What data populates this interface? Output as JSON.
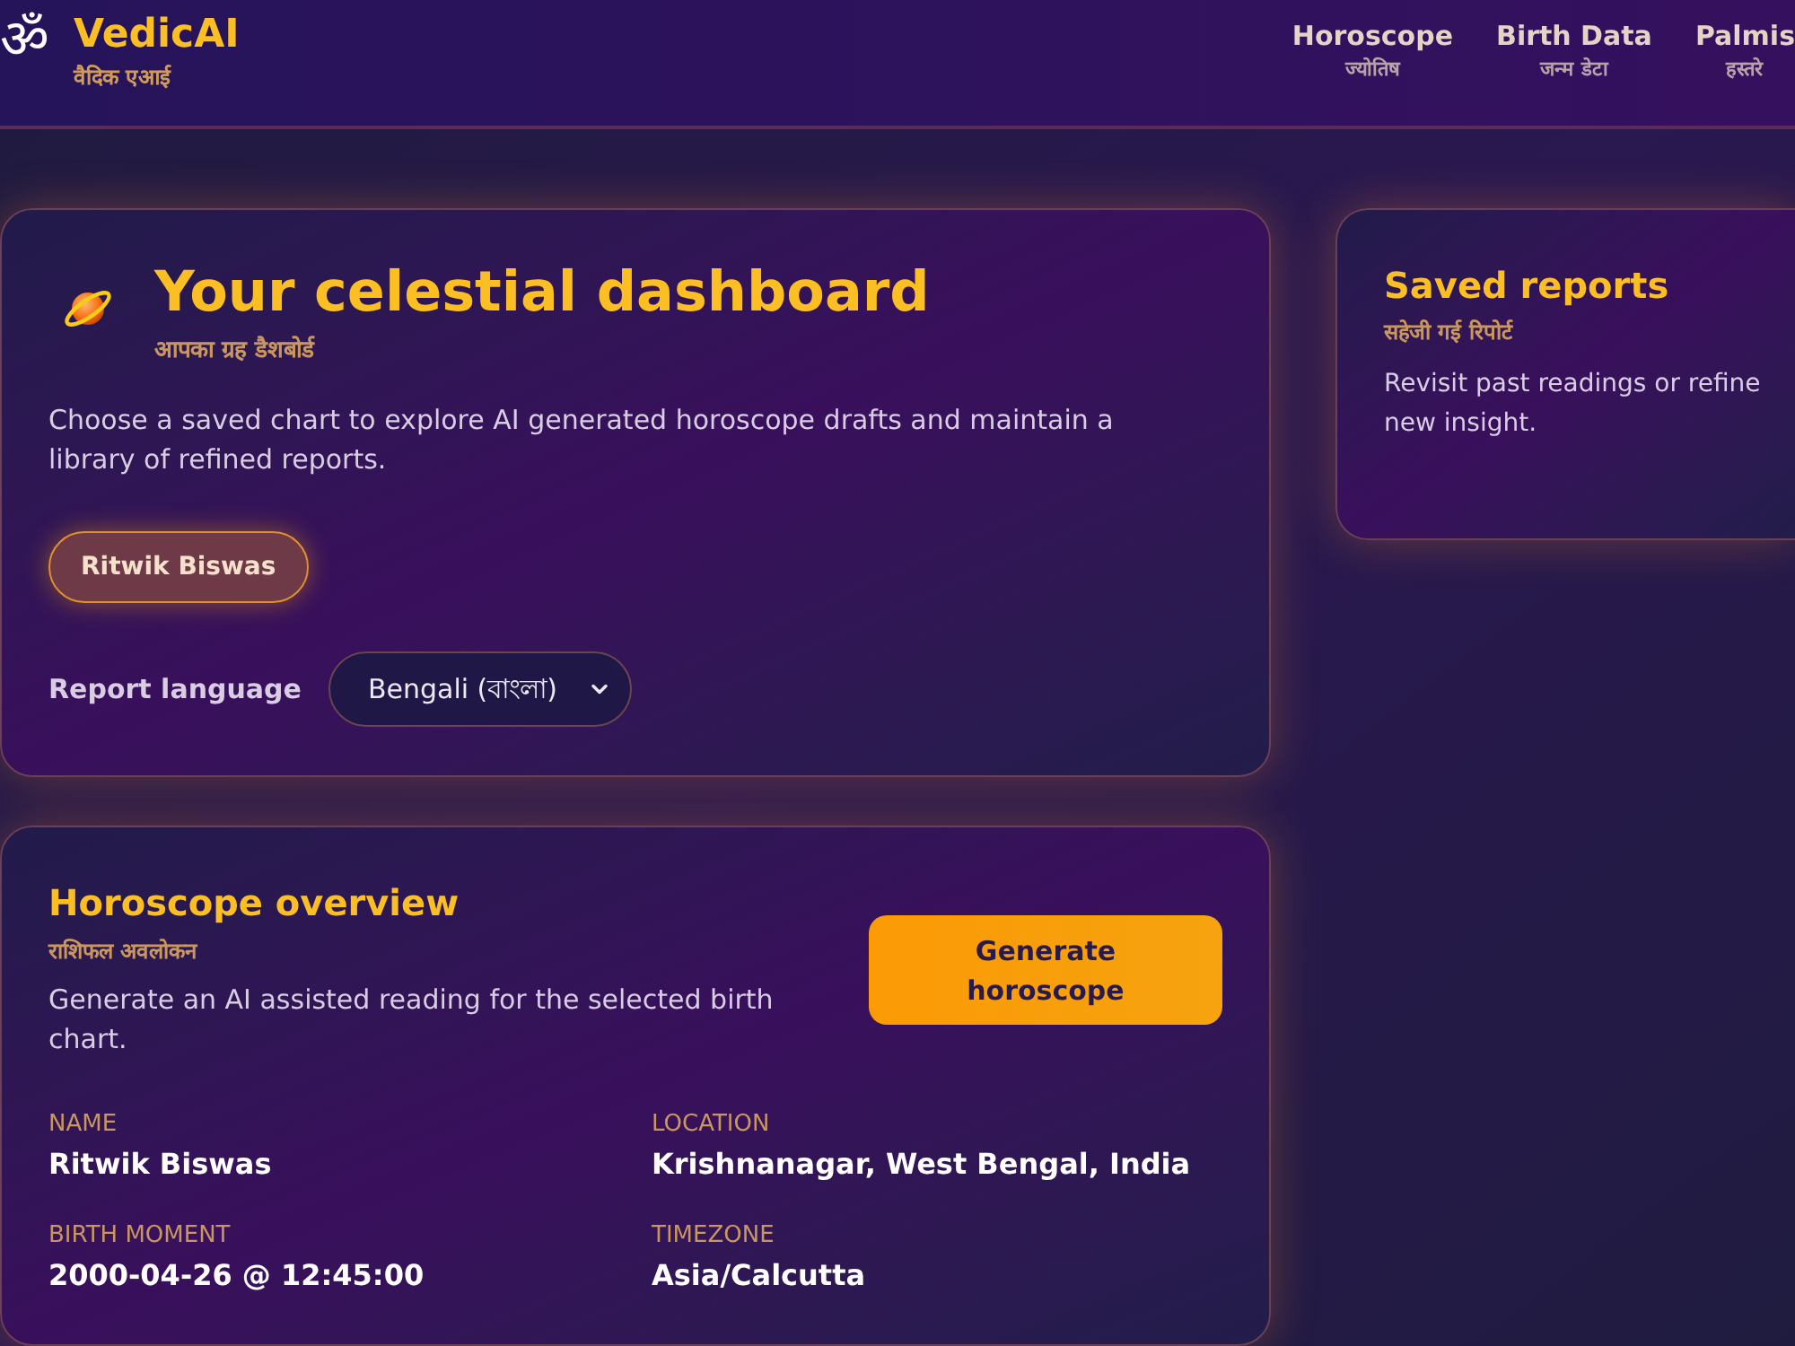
{
  "header": {
    "logo_symbol": "ॐ",
    "brand": "VedicAI",
    "brand_subtitle": "वैदिक एआई",
    "nav": [
      {
        "label": "Horoscope",
        "sublabel": "ज्योतिष"
      },
      {
        "label": "Birth Data",
        "sublabel": "जन्म डेटा"
      },
      {
        "label": "Palmis",
        "sublabel": "हस्तरे"
      }
    ]
  },
  "dashboard": {
    "title": "Your celestial dashboard",
    "subtitle": "आपका ग्रह डैशबोर्ड",
    "description": "Choose a saved chart to explore AI generated horoscope drafts and maintain a library of refined reports.",
    "charts": [
      {
        "label": "Ritwik Biswas",
        "selected": true
      }
    ],
    "language_label": "Report language",
    "language_value": "Bengali (বাংলা)"
  },
  "saved_reports": {
    "title": "Saved reports",
    "subtitle": "सहेजी गई रिपोर्ट",
    "description": "Revisit past readings or refine new insight."
  },
  "overview": {
    "title": "Horoscope overview",
    "subtitle": "राशिफल अवलोकन",
    "description": "Generate an AI assisted reading for the selected birth chart.",
    "button": "Generate horoscope",
    "fields": [
      {
        "label": "NAME",
        "value": "Ritwik Biswas"
      },
      {
        "label": "LOCATION",
        "value": "Krishnanagar, West Bengal, India"
      },
      {
        "label": "BIRTH MOMENT",
        "value": "2000-04-26 @ 12:45:00"
      },
      {
        "label": "TIMEZONE",
        "value": "Asia/Calcutta"
      }
    ]
  }
}
